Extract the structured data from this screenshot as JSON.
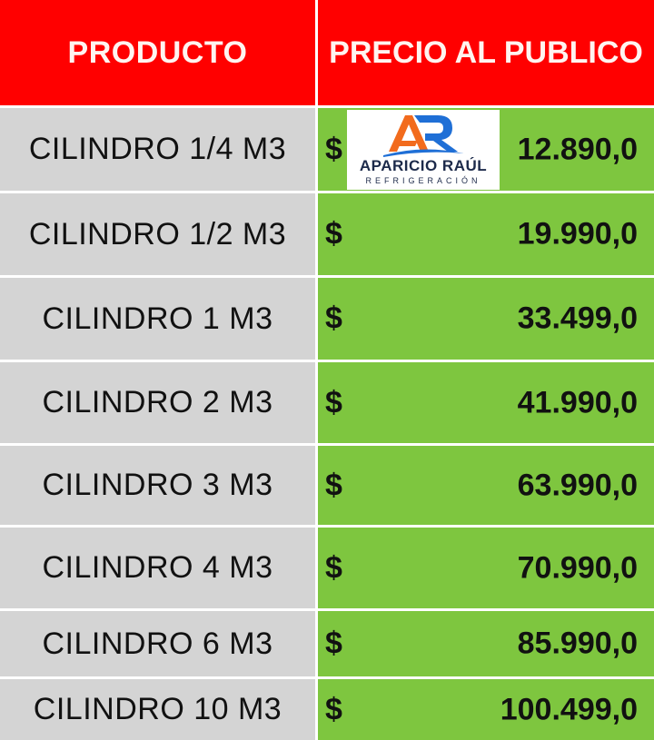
{
  "header": {
    "product": "PRODUCTO",
    "price": "PRECIO AL PUBLICO"
  },
  "rows": [
    {
      "product": "CILINDRO 1/4 M3",
      "currency": "$",
      "price": "12.890,0"
    },
    {
      "product": "CILINDRO 1/2 M3",
      "currency": "$",
      "price": "19.990,0"
    },
    {
      "product": "CILINDRO 1 M3",
      "currency": "$",
      "price": "33.499,0"
    },
    {
      "product": "CILINDRO 2 M3",
      "currency": "$",
      "price": "41.990,0"
    },
    {
      "product": "CILINDRO 3 M3",
      "currency": "$",
      "price": "63.990,0"
    },
    {
      "product": "CILINDRO 4 M3",
      "currency": "$",
      "price": "70.990,0"
    },
    {
      "product": "CILINDRO 6 M3",
      "currency": "$",
      "price": "85.990,0"
    },
    {
      "product": "CILINDRO 10 M3",
      "currency": "$",
      "price": "100.499,0"
    }
  ],
  "logo": {
    "brand": "APARICIO RAÚL",
    "subtitle": "REFRIGERACIÓN",
    "colors": {
      "orange": "#f26b1d",
      "blue": "#1f6fd6",
      "navy": "#1c2a4a"
    }
  },
  "colors": {
    "header_bg": "#ff0000",
    "product_bg": "#d4d4d4",
    "price_bg": "#7ec63f"
  }
}
